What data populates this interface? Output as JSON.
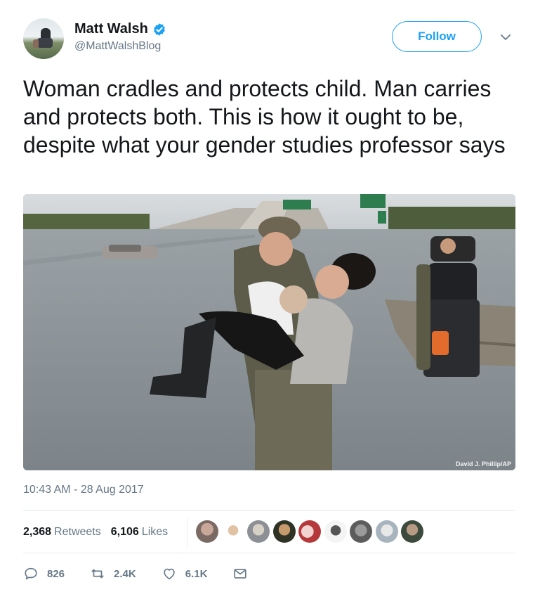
{
  "tweet": {
    "author": {
      "name": "Matt Walsh",
      "handle": "@MattWalshBlog",
      "verified_icon": "verified-badge-icon"
    },
    "follow_label": "Follow",
    "text": "Woman cradles and protects child. Man carries and protects both. This is how it ought to be, despite what your gender studies professor says",
    "photo_credit": "David J. Phillip/AP",
    "timestamp": "10:43 AM - 28 Aug 2017",
    "stats": {
      "retweets_count": "2,368",
      "retweets_label": "Retweets",
      "likes_count": "6,106",
      "likes_label": "Likes"
    },
    "actions": {
      "reply_count": "826",
      "retweet_count": "2.4K",
      "like_count": "6.1K"
    }
  },
  "colors": {
    "accent": "#1da1f2",
    "secondary_text": "#657786",
    "primary_text": "#14171a"
  }
}
